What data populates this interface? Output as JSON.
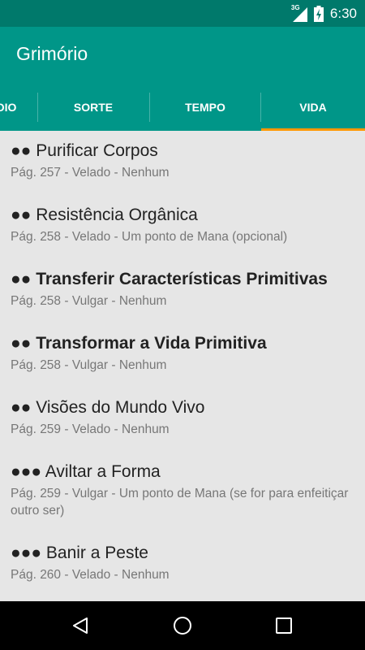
{
  "status": {
    "network_label": "3G",
    "time": "6:30",
    "icons": [
      "signal-icon",
      "battery-charging-icon"
    ]
  },
  "app": {
    "title": "Grimório"
  },
  "tabs": {
    "items": [
      {
        "label": "DIO"
      },
      {
        "label": "SORTE"
      },
      {
        "label": "TEMPO"
      },
      {
        "label": "VIDA"
      }
    ],
    "selected": "VIDA"
  },
  "spells": [
    {
      "dots": "●●",
      "name": "Purificar Corpos",
      "detail": "Pág. 257 - Velado - Nenhum",
      "bold": false
    },
    {
      "dots": "●●",
      "name": "Resistência Orgânica",
      "detail": "Pág. 258 - Velado - Um ponto de Mana (opcional)",
      "bold": false
    },
    {
      "dots": "●●",
      "name": "Transferir Características Primitivas",
      "detail": "Pág. 258 - Vulgar - Nenhum",
      "bold": true
    },
    {
      "dots": "●●",
      "name": "Transformar a Vida Primitiva",
      "detail": "Pág. 258 - Vulgar - Nenhum",
      "bold": true
    },
    {
      "dots": "●●",
      "name": "Visões do Mundo Vivo",
      "detail": "Pág. 259 - Velado - Nenhum",
      "bold": false
    },
    {
      "dots": "●●●",
      "name": "Aviltar a Forma",
      "detail": "Pág. 259 - Vulgar - Um ponto de Mana (se for para enfeitiçar outro ser)",
      "bold": false
    },
    {
      "dots": "●●●",
      "name": "Banir a Peste",
      "detail": "Pág. 260 - Velado - Nenhum",
      "bold": false
    }
  ],
  "navbar": {
    "buttons": [
      "back-icon",
      "home-icon",
      "recents-icon"
    ]
  },
  "colors": {
    "status_bar": "#00796b",
    "app_bar": "#009688",
    "tab_indicator": "#ff9800",
    "list_background": "#e6e6e6"
  }
}
